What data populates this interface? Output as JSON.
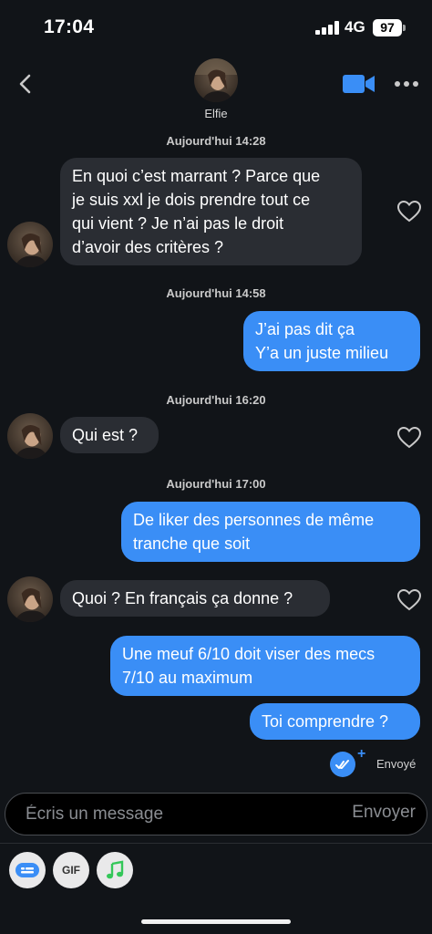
{
  "status_bar": {
    "time": "17:04",
    "network": "4G",
    "battery": "97"
  },
  "header": {
    "contact_name": "Elfie"
  },
  "conversation": {
    "blocks": [
      {
        "timestamp": "Aujourd'hui 14:28"
      },
      {
        "timestamp": "Aujourd'hui 14:58"
      },
      {
        "timestamp": "Aujourd'hui 16:20"
      },
      {
        "timestamp": "Aujourd'hui 17:00"
      }
    ],
    "messages": [
      {
        "from": "them",
        "lines": [
          "En quoi c’est marrant ? Parce que",
          "je suis xxl je dois prendre tout ce",
          "qui vient ? Je n’ai pas le droit",
          "d’avoir des critères ?"
        ]
      },
      {
        "from": "me",
        "lines": [
          "J’ai pas dit ça",
          "Y’a un juste milieu"
        ]
      },
      {
        "from": "them",
        "lines": [
          "Qui est ?"
        ]
      },
      {
        "from": "me",
        "lines": [
          "De liker des personnes de même",
          "tranche que soit"
        ]
      },
      {
        "from": "them",
        "lines": [
          "Quoi ? En français ça donne ?"
        ]
      },
      {
        "from": "me",
        "lines": [
          "Une meuf 6/10 doit viser des mecs",
          "7/10 au maximum"
        ]
      },
      {
        "from": "me",
        "lines": [
          "Toi comprendre ?"
        ]
      }
    ],
    "delivery_status": "Envoyé"
  },
  "composer": {
    "placeholder": "Écris un message",
    "send_label": "Envoyer"
  },
  "toolbar": {
    "gif_label": "GIF",
    "icons": [
      "sticker-icon",
      "gif-icon",
      "music-note-icon"
    ]
  },
  "colors": {
    "background": "#111418",
    "incoming_bubble": "#2a2d33",
    "outgoing_bubble": "#3a8ef6",
    "music_green": "#34c759"
  }
}
